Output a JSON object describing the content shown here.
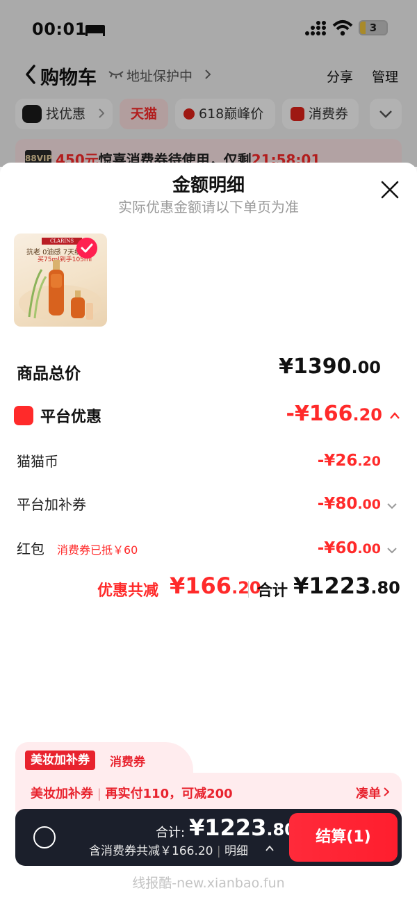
{
  "status_bar": {
    "time": "00:01",
    "battery": "3"
  },
  "cart_header": {
    "title": "购物车",
    "address": "地址保护中",
    "share": "分享",
    "manage": "管理"
  },
  "filters": [
    "找优惠",
    "天猫",
    "618巅峰价",
    "消费券"
  ],
  "promo_strip": {
    "badge": "88VIP",
    "amount": "450元",
    "text": "惊喜消费券待使用，仅剩",
    "countdown": "21:58:01"
  },
  "sheet": {
    "title": "金额明细",
    "subtitle": "实际优惠金额请以下单页为准",
    "product": {
      "brand": "CLARINS",
      "line1": "抗老 0油感 7天细",
      "line2": "买75ml到手105ml"
    },
    "total_label": "商品总价",
    "total_price": {
      "main": "¥1390",
      "dec": ".00"
    },
    "platform_label": "平台优惠",
    "platform_price": {
      "main": "-¥166",
      "dec": ".20"
    },
    "items": [
      {
        "label": "猫猫币",
        "price_main": "-¥26",
        "price_dec": ".20"
      },
      {
        "label": "平台加补券",
        "price_main": "-¥80",
        "price_dec": ".00"
      },
      {
        "label": "红包",
        "note": "消费券已抵￥60",
        "price_main": "-¥60",
        "price_dec": ".00"
      }
    ],
    "summary": {
      "discount_label": "优惠共减",
      "discount_main": "¥166",
      "discount_dec": ".20",
      "total_label": "合计",
      "total_main": "¥1223",
      "total_dec": ".80"
    }
  },
  "coupon": {
    "tag": "美妆加补券",
    "tab_label": "消费券",
    "text_a": "美妆加补券",
    "text_b": "再实付110，可减200",
    "action": "凑单"
  },
  "checkout": {
    "total_label": "合计:",
    "total_main": "¥1223",
    "total_dec": ".80",
    "sub_text": "含消费券共减￥166.20",
    "detail": "明细",
    "button": "结算(1)"
  },
  "watermark": "线报酷-new.xianbao.fun",
  "colors": {
    "accent": "#ff2a2a",
    "checkout_bar": "#1b1f2b",
    "coupon_bg": "#ffecee"
  }
}
